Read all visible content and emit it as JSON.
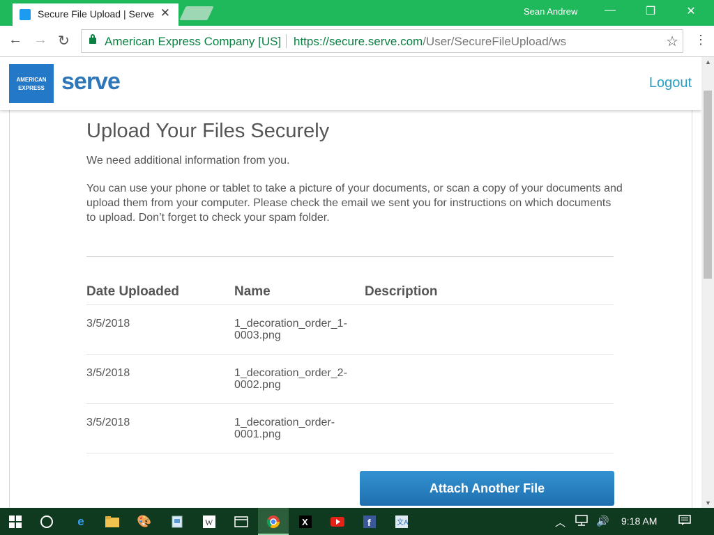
{
  "browser": {
    "tab_title": "Secure File Upload | Serve",
    "profile_name": "Sean Andrew",
    "ev_label": "American Express Company [US]",
    "url_host": "https://secure.serve.com",
    "url_path": "/User/SecureFileUpload/ws"
  },
  "header": {
    "amex_line1": "AMERICAN",
    "amex_line2": "EXPRESS",
    "brand": "serve",
    "logout_label": "Logout"
  },
  "main": {
    "title": "Upload Your Files Securely",
    "intro": "We need additional information from you.",
    "instructions": "You can use your phone or tablet to take a picture of your documents, or scan a copy of your documents and upload them from your computer. Please check the email we sent you for instructions on which documents to upload. Don’t forget to check your spam folder.",
    "table": {
      "headers": [
        "Date Uploaded",
        "Name",
        "Description"
      ],
      "rows": [
        {
          "date": "3/5/2018",
          "name": "1_decoration_order_1-0003.png",
          "description": ""
        },
        {
          "date": "3/5/2018",
          "name": "1_decoration_order_2-0002.png",
          "description": ""
        },
        {
          "date": "3/5/2018",
          "name": "1_decoration_order-0001.png",
          "description": ""
        }
      ]
    },
    "attach_label": "Attach Another File"
  },
  "taskbar": {
    "clock": "9:18 AM"
  },
  "colors": {
    "titlebar": "#1fb85b",
    "link": "#2a9ec6",
    "button": "#2a82c2",
    "taskbar": "#0f3a1f"
  }
}
